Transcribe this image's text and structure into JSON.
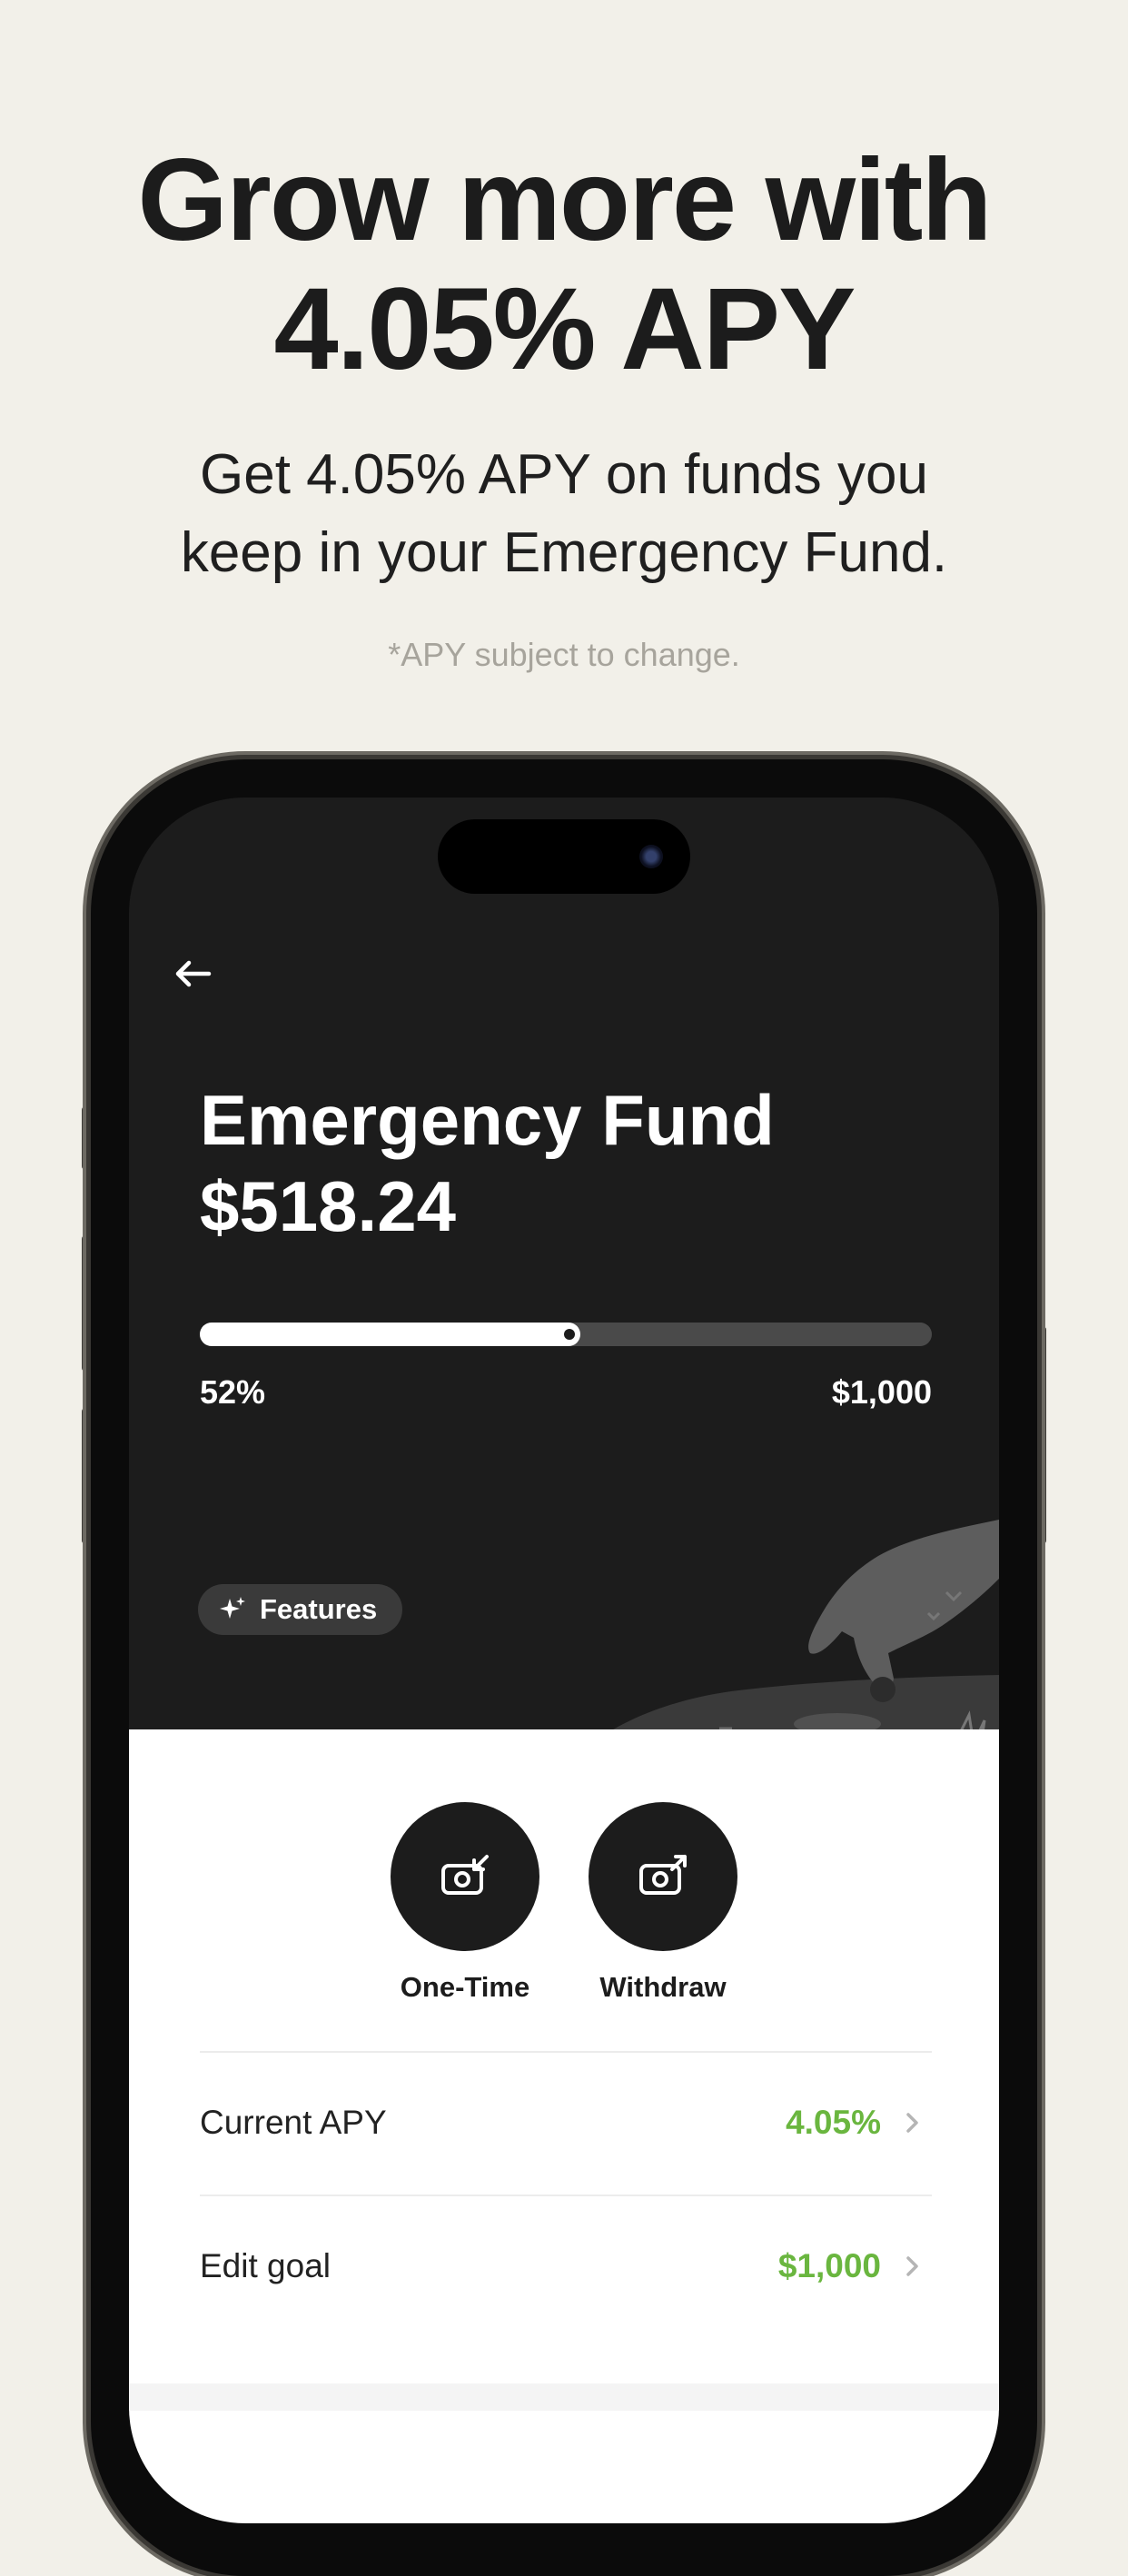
{
  "promo": {
    "headline_line1": "Grow more with",
    "headline_line2": "4.05% APY",
    "subtitle_line1": "Get 4.05% APY on funds you",
    "subtitle_line2": "keep in your Emergency Fund.",
    "disclaimer": "*APY subject to change."
  },
  "screen": {
    "title": "Emergency Fund",
    "balance": "$518.24",
    "progress": {
      "percent_label": "52%",
      "value_percent": 52,
      "goal_label": "$1,000"
    },
    "features_label": "Features",
    "actions": [
      {
        "label": "One-Time",
        "icon": "deposit-icon"
      },
      {
        "label": "Withdraw",
        "icon": "withdraw-icon"
      }
    ],
    "rows": [
      {
        "label": "Current APY",
        "value": "4.05%"
      },
      {
        "label": "Edit goal",
        "value": "$1,000"
      }
    ]
  },
  "colors": {
    "background": "#f2f0e9",
    "dark_panel": "#1c1c1c",
    "accent_green": "#6ab63f"
  }
}
